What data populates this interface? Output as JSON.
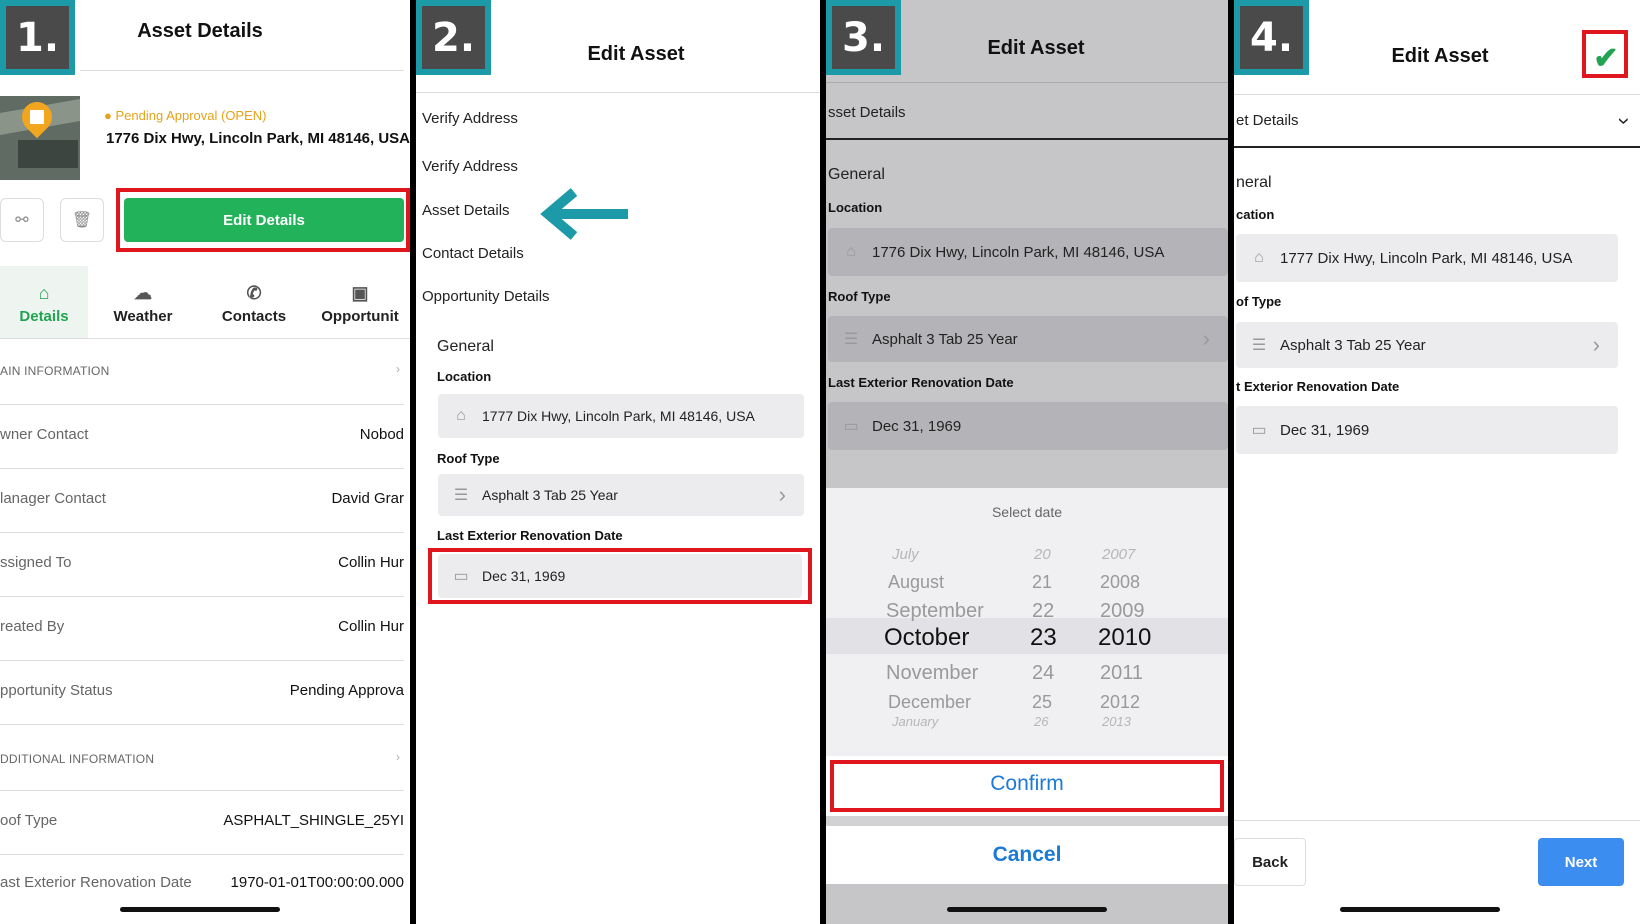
{
  "panel1": {
    "step": "1.",
    "title": "Asset Details",
    "status": "Pending Approval (OPEN)",
    "address": "1776 Dix Hwy, Lincoln Park, MI 48146, USA",
    "edit_button": "Edit Details",
    "tabs": [
      "Details",
      "Weather",
      "Contacts",
      "Opportunit"
    ],
    "section_main": "AIN INFORMATION",
    "section_additional": "DDITIONAL INFORMATION",
    "rows": [
      {
        "label": "wner Contact",
        "value": "Nobod"
      },
      {
        "label": "lanager Contact",
        "value": "David Grar"
      },
      {
        "label": "ssigned To",
        "value": "Collin Hur"
      },
      {
        "label": "reated By",
        "value": "Collin Hur"
      },
      {
        "label": "pportunity Status",
        "value": "Pending Approva"
      }
    ],
    "rows2": [
      {
        "label": "oof Type",
        "value": "ASPHALT_SHINGLE_25YI"
      },
      {
        "label": "ast Exterior Renovation Date",
        "value": "1970-01-01T00:00:00.000"
      }
    ]
  },
  "panel2": {
    "step": "2.",
    "title": "Edit Asset",
    "menu": [
      "Verify Address",
      "Verify Address",
      "Asset Details",
      "Contact Details",
      "Opportunity Details"
    ],
    "general": "General",
    "location_label": "Location",
    "location_value": "1777 Dix Hwy, Lincoln Park, MI 48146, USA",
    "roof_label": "Roof Type",
    "roof_value": "Asphalt 3 Tab 25 Year",
    "date_label": "Last Exterior Renovation Date",
    "date_value": "Dec 31, 1969"
  },
  "panel3": {
    "step": "3.",
    "title": "Edit Asset",
    "section": "sset Details",
    "general": "General",
    "location_label": "Location",
    "location_value": "1776 Dix Hwy, Lincoln Park, MI 48146, USA",
    "roof_label": "Roof Type",
    "roof_value": "Asphalt 3 Tab 25 Year",
    "date_label": "Last Exterior Renovation Date",
    "date_value": "Dec 31, 1969",
    "picker_title": "Select date",
    "months": [
      "July",
      "August",
      "September",
      "October",
      "November",
      "December",
      "January"
    ],
    "days": [
      "20",
      "21",
      "22",
      "23",
      "24",
      "25",
      "26"
    ],
    "years": [
      "2007",
      "2008",
      "2009",
      "2010",
      "2011",
      "2012",
      "2013"
    ],
    "confirm": "Confirm",
    "cancel": "Cancel"
  },
  "panel4": {
    "step": "4.",
    "title": "Edit Asset",
    "section": "et Details",
    "general": "neral",
    "location_label": "cation",
    "location_value": "1777 Dix Hwy, Lincoln Park, MI 48146, USA",
    "roof_label": "of Type",
    "roof_value": "Asphalt 3 Tab 25 Year",
    "date_label": "t Exterior Renovation Date",
    "date_value": "Dec 31, 1969",
    "back": "Back",
    "next": "Next"
  },
  "colors": {
    "badge_teal": "#1d9aa7",
    "highlight_red": "#e0161f",
    "brand_green": "#22b25a",
    "ios_blue": "#1b7ad6",
    "next_blue": "#3b8df0",
    "pending_orange": "#e6a21b"
  },
  "icons": {
    "share": "share-icon",
    "trash": "trash-icon",
    "home": "home-icon",
    "cloud": "cloud-icon",
    "phone": "phone-icon",
    "briefcase": "briefcase-icon",
    "list": "list-icon",
    "calendar": "calendar-icon",
    "chevron": "chevron-right-icon",
    "check": "checkmark-icon",
    "arrow": "arrow-left-icon"
  }
}
